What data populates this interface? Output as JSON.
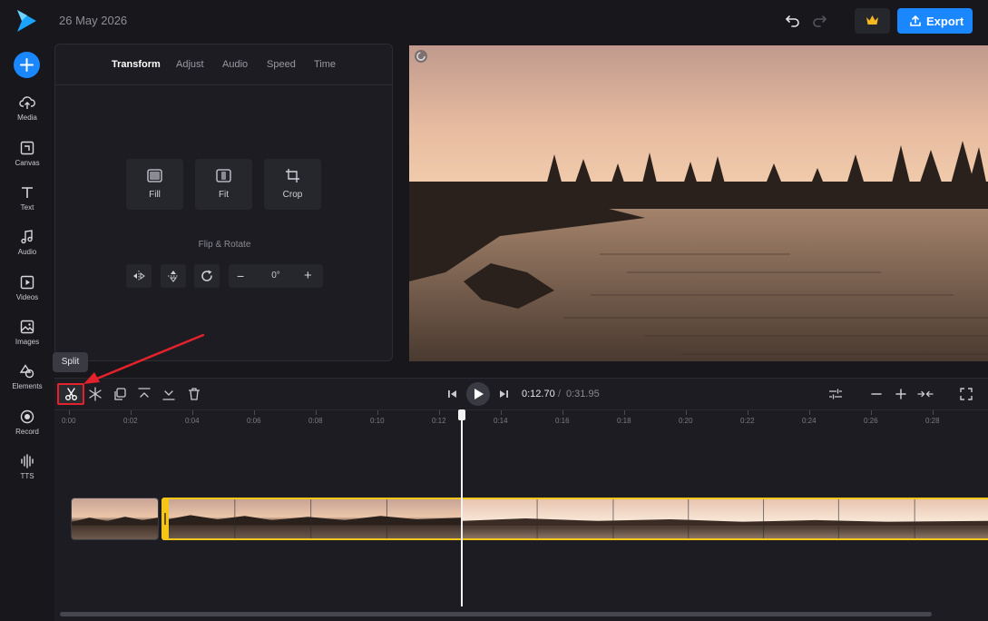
{
  "header": {
    "date": "26 May 2026",
    "export_label": "Export",
    "icons": [
      "logo-icon",
      "undo-icon",
      "redo-icon",
      "crown-icon",
      "upload-icon"
    ]
  },
  "sidebar": {
    "items": [
      {
        "label": "Media",
        "icon": "upload-cloud-icon"
      },
      {
        "label": "Canvas",
        "icon": "canvas-icon"
      },
      {
        "label": "Text",
        "icon": "text-icon"
      },
      {
        "label": "Audio",
        "icon": "music-note-icon"
      },
      {
        "label": "Videos",
        "icon": "video-icon"
      },
      {
        "label": "Images",
        "icon": "image-icon"
      },
      {
        "label": "Elements",
        "icon": "shapes-icon"
      },
      {
        "label": "Record",
        "icon": "record-icon"
      },
      {
        "label": "TTS",
        "icon": "waveform-icon"
      }
    ]
  },
  "panel": {
    "tabs": [
      "Transform",
      "Adjust",
      "Audio",
      "Speed",
      "Time"
    ],
    "active_tab": "Transform",
    "fit_options": [
      "Fill",
      "Fit",
      "Crop"
    ],
    "flip_rotate_label": "Flip & Rotate",
    "rotation_value": "0°"
  },
  "timeline": {
    "tooltip": "Split",
    "current_time": "0:12.70",
    "separator": "/",
    "total_time": "0:31.95",
    "ruler": [
      "0:00",
      "0:02",
      "0:04",
      "0:06",
      "0:08",
      "0:10",
      "0:12",
      "0:14",
      "0:16",
      "0:18",
      "0:20",
      "0:22",
      "0:24",
      "0:26",
      "0:28"
    ]
  },
  "colors": {
    "accent": "#1a87ff",
    "selection": "#f5c518",
    "highlight": "#e3222b"
  }
}
